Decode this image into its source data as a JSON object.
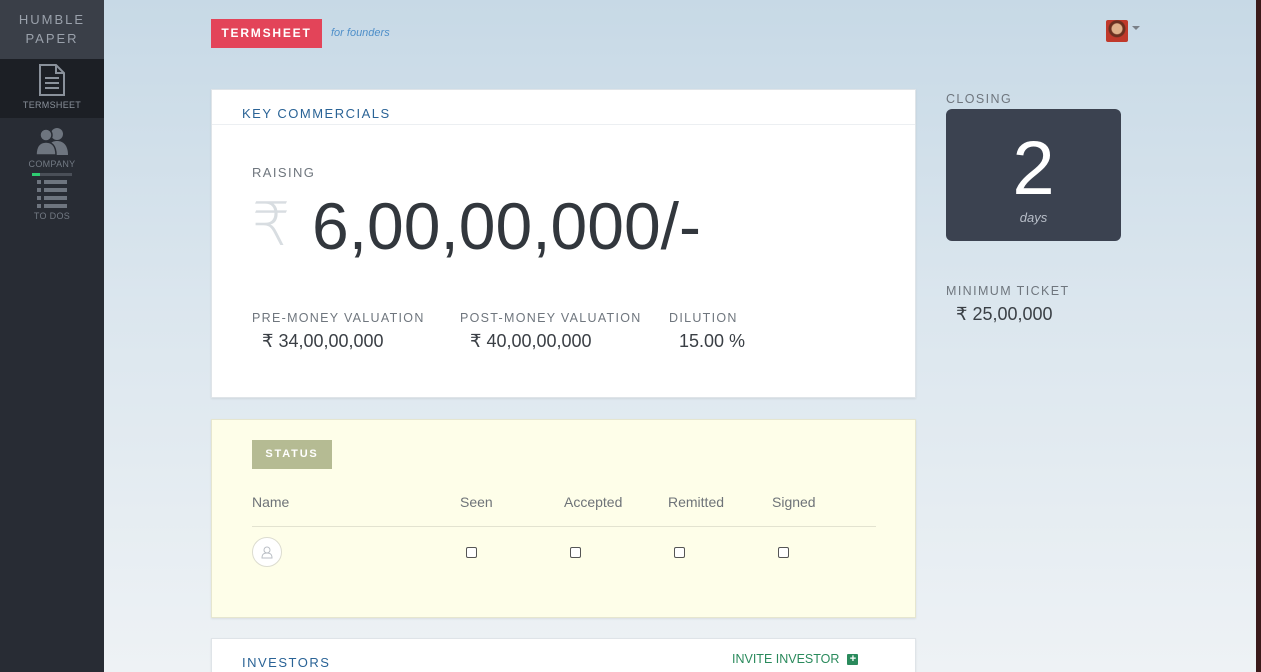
{
  "sidebar": {
    "brand_line1": "HUMBLE",
    "brand_line2": "PAPER",
    "items": [
      {
        "label": "TERMSHEET",
        "icon": "document-icon",
        "active": true
      },
      {
        "label": "COMPANY",
        "icon": "users-icon",
        "active": false,
        "progress": 0.2
      },
      {
        "label": "TO DOS",
        "icon": "list-icon",
        "active": false
      }
    ]
  },
  "header": {
    "logo": "TERMSHEET",
    "tagline": "for founders"
  },
  "key_commercials": {
    "title": "KEY COMMERCIALS",
    "raising_label": "RAISING",
    "currency_symbol": "₹",
    "raising_amount": "6,00,00,000/-",
    "metrics": [
      {
        "label": "PRE-MONEY VALUATION",
        "value": "₹ 34,00,00,000"
      },
      {
        "label": "POST-MONEY VALUATION",
        "value": "₹ 40,00,00,000"
      },
      {
        "label": "DILUTION",
        "value": "15.00 %"
      }
    ]
  },
  "status": {
    "badge": "STATUS",
    "columns": [
      "Name",
      "Seen",
      "Accepted",
      "Remitted",
      "Signed"
    ],
    "rows": [
      {
        "name": "",
        "seen": false,
        "accepted": false,
        "remitted": false,
        "signed": false
      }
    ]
  },
  "investors": {
    "title": "INVESTORS",
    "invite_label": "INVITE INVESTOR"
  },
  "closing": {
    "label": "CLOSING",
    "value": "2",
    "unit": "days"
  },
  "minimum_ticket": {
    "label": "MINIMUM TICKET",
    "value": "₹ 25,00,000"
  },
  "colors": {
    "brand_red": "#e34459",
    "sidebar_bg": "#282c34",
    "status_bg": "#fefee9",
    "closing_bg": "#3b4250",
    "link_green": "#2a8a5c",
    "heading_blue": "#2a6396"
  }
}
